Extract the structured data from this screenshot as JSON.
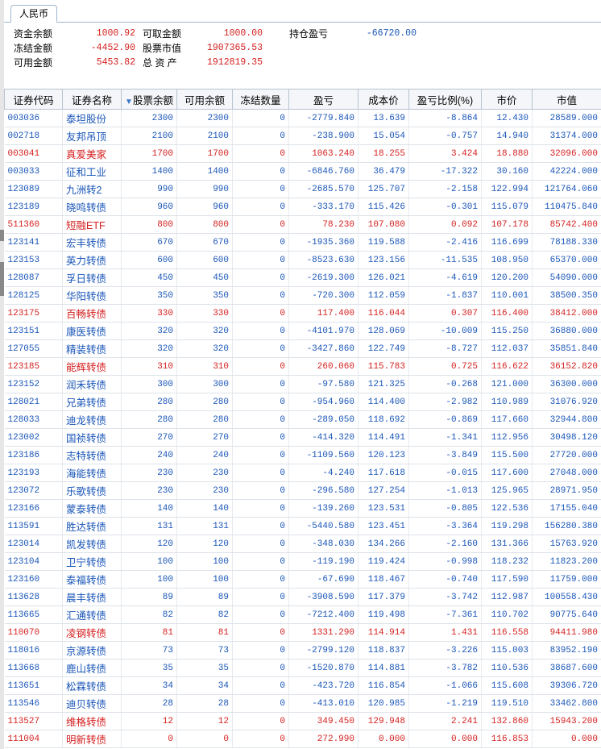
{
  "tab": "人民币",
  "summary": {
    "row1": [
      {
        "label": "资金余额",
        "value": "1000.92"
      },
      {
        "label": "可取金额",
        "value": "1000.00"
      },
      {
        "label": "持仓盈亏",
        "value": "-66720.00"
      }
    ],
    "row2": [
      {
        "label": "冻结金额",
        "value": "-4452.90"
      },
      {
        "label": "股票市值",
        "value": "1907365.53"
      }
    ],
    "row3": [
      {
        "label": "可用金额",
        "value": "5453.82"
      },
      {
        "label": "总 资 产",
        "value": "1912819.35"
      }
    ]
  },
  "table": {
    "sort_icon": "▼",
    "columns": [
      "证券代码",
      "证券名称",
      "股票余额",
      "可用余额",
      "冻结数量",
      "盈亏",
      "成本价",
      "盈亏比例(%)",
      "市价",
      "市值"
    ],
    "rows": [
      [
        "003036",
        "泰坦股份",
        "2300",
        "2300",
        "0",
        "-2779.840",
        "13.639",
        "-8.864",
        "12.430",
        "28589.000"
      ],
      [
        "002718",
        "友邦吊顶",
        "2100",
        "2100",
        "0",
        "-238.900",
        "15.054",
        "-0.757",
        "14.940",
        "31374.000"
      ],
      [
        "003041",
        "真爱美家",
        "1700",
        "1700",
        "0",
        "1063.240",
        "18.255",
        "3.424",
        "18.880",
        "32096.000"
      ],
      [
        "003033",
        "征和工业",
        "1400",
        "1400",
        "0",
        "-6846.760",
        "36.479",
        "-17.322",
        "30.160",
        "42224.000"
      ],
      [
        "123089",
        "九洲转2",
        "990",
        "990",
        "0",
        "-2685.570",
        "125.707",
        "-2.158",
        "122.994",
        "121764.060"
      ],
      [
        "123189",
        "晓鸣转债",
        "960",
        "960",
        "0",
        "-333.170",
        "115.426",
        "-0.301",
        "115.079",
        "110475.840"
      ],
      [
        "511360",
        "短融ETF",
        "800",
        "800",
        "0",
        "78.230",
        "107.080",
        "0.092",
        "107.178",
        "85742.400"
      ],
      [
        "123141",
        "宏丰转债",
        "670",
        "670",
        "0",
        "-1935.360",
        "119.588",
        "-2.416",
        "116.699",
        "78188.330"
      ],
      [
        "123153",
        "英力转债",
        "600",
        "600",
        "0",
        "-8523.630",
        "123.156",
        "-11.535",
        "108.950",
        "65370.000"
      ],
      [
        "128087",
        "孚日转债",
        "450",
        "450",
        "0",
        "-2619.300",
        "126.021",
        "-4.619",
        "120.200",
        "54090.000"
      ],
      [
        "128125",
        "华阳转债",
        "350",
        "350",
        "0",
        "-720.300",
        "112.059",
        "-1.837",
        "110.001",
        "38500.350"
      ],
      [
        "123175",
        "百畅转债",
        "330",
        "330",
        "0",
        "117.400",
        "116.044",
        "0.307",
        "116.400",
        "38412.000"
      ],
      [
        "123151",
        "康医转债",
        "320",
        "320",
        "0",
        "-4101.970",
        "128.069",
        "-10.009",
        "115.250",
        "36880.000"
      ],
      [
        "127055",
        "精装转债",
        "320",
        "320",
        "0",
        "-3427.860",
        "122.749",
        "-8.727",
        "112.037",
        "35851.840"
      ],
      [
        "123185",
        "能辉转债",
        "310",
        "310",
        "0",
        "260.060",
        "115.783",
        "0.725",
        "116.622",
        "36152.820"
      ],
      [
        "123152",
        "润禾转债",
        "300",
        "300",
        "0",
        "-97.580",
        "121.325",
        "-0.268",
        "121.000",
        "36300.000"
      ],
      [
        "128021",
        "兄弟转债",
        "280",
        "280",
        "0",
        "-954.960",
        "114.400",
        "-2.982",
        "110.989",
        "31076.920"
      ],
      [
        "128033",
        "迪龙转债",
        "280",
        "280",
        "0",
        "-289.050",
        "118.692",
        "-0.869",
        "117.660",
        "32944.800"
      ],
      [
        "123002",
        "国祯转债",
        "270",
        "270",
        "0",
        "-414.320",
        "114.491",
        "-1.341",
        "112.956",
        "30498.120"
      ],
      [
        "123186",
        "志特转债",
        "240",
        "240",
        "0",
        "-1109.560",
        "120.123",
        "-3.849",
        "115.500",
        "27720.000"
      ],
      [
        "123193",
        "海能转债",
        "230",
        "230",
        "0",
        "-4.240",
        "117.618",
        "-0.015",
        "117.600",
        "27048.000"
      ],
      [
        "123072",
        "乐歌转债",
        "230",
        "230",
        "0",
        "-296.580",
        "127.254",
        "-1.013",
        "125.965",
        "28971.950"
      ],
      [
        "123166",
        "蒙泰转债",
        "140",
        "140",
        "0",
        "-139.260",
        "123.531",
        "-0.805",
        "122.536",
        "17155.040"
      ],
      [
        "113591",
        "胜达转债",
        "131",
        "131",
        "0",
        "-5440.580",
        "123.451",
        "-3.364",
        "119.298",
        "156280.380"
      ],
      [
        "123014",
        "凯发转债",
        "120",
        "120",
        "0",
        "-348.030",
        "134.266",
        "-2.160",
        "131.366",
        "15763.920"
      ],
      [
        "123104",
        "卫宁转债",
        "100",
        "100",
        "0",
        "-119.190",
        "119.424",
        "-0.998",
        "118.232",
        "11823.200"
      ],
      [
        "123160",
        "泰福转债",
        "100",
        "100",
        "0",
        "-67.690",
        "118.467",
        "-0.740",
        "117.590",
        "11759.000"
      ],
      [
        "113628",
        "晨丰转债",
        "89",
        "89",
        "0",
        "-3908.590",
        "117.379",
        "-3.742",
        "112.987",
        "100558.430"
      ],
      [
        "113665",
        "汇通转债",
        "82",
        "82",
        "0",
        "-7212.400",
        "119.498",
        "-7.361",
        "110.702",
        "90775.640"
      ],
      [
        "110070",
        "凌钢转债",
        "81",
        "81",
        "0",
        "1331.290",
        "114.914",
        "1.431",
        "116.558",
        "94411.980"
      ],
      [
        "118016",
        "京源转债",
        "73",
        "73",
        "0",
        "-2799.120",
        "118.837",
        "-3.226",
        "115.003",
        "83952.190"
      ],
      [
        "113668",
        "鹿山转债",
        "35",
        "35",
        "0",
        "-1520.870",
        "114.881",
        "-3.782",
        "110.536",
        "38687.600"
      ],
      [
        "113651",
        "松霖转债",
        "34",
        "34",
        "0",
        "-423.720",
        "116.854",
        "-1.066",
        "115.608",
        "39306.720"
      ],
      [
        "113546",
        "迪贝转债",
        "28",
        "28",
        "0",
        "-413.010",
        "120.985",
        "-1.219",
        "119.510",
        "33462.800"
      ],
      [
        "113527",
        "维格转债",
        "12",
        "12",
        "0",
        "349.450",
        "129.948",
        "2.241",
        "132.860",
        "15943.200"
      ],
      [
        "111004",
        "明新转债",
        "0",
        "0",
        "0",
        "272.990",
        "0.000",
        "0.000",
        "116.853",
        "0.000"
      ]
    ]
  }
}
